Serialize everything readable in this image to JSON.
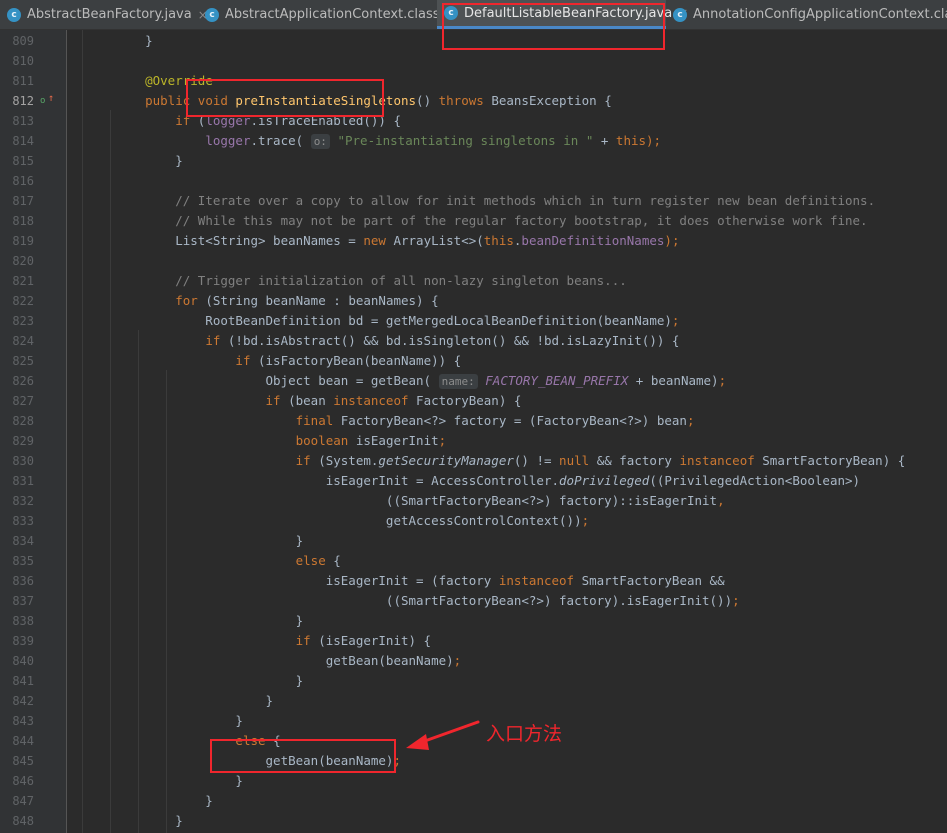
{
  "tabs": [
    {
      "name": "AbstractBeanFactory.java",
      "icon": "c",
      "active": false
    },
    {
      "name": "AbstractApplicationContext.class",
      "icon": "c",
      "active": false
    },
    {
      "name": "DefaultListableBeanFactory.java",
      "icon": "c",
      "active": true
    },
    {
      "name": "AnnotationConfigApplicationContext.class",
      "icon": "c",
      "active": false
    }
  ],
  "close_glyph": "×",
  "current_line": "812",
  "gutter_markers": [
    "o",
    "↑"
  ],
  "annotation_note": "入口方法",
  "lines": [
    {
      "n": "809",
      "t": [
        {
          "s": "    }"
        }
      ]
    },
    {
      "n": "810",
      "t": []
    },
    {
      "n": "811",
      "t": [
        {
          "s": "    "
        },
        {
          "s": "@Override",
          "c": "an"
        }
      ]
    },
    {
      "n": "812",
      "t": [
        {
          "s": "    "
        },
        {
          "s": "public void ",
          "c": "kw"
        },
        {
          "s": "preInstantiateSingletons",
          "c": "fnd"
        },
        {
          "s": "() "
        },
        {
          "s": "throws ",
          "c": "kw"
        },
        {
          "s": "BeansException {"
        }
      ]
    },
    {
      "n": "813",
      "t": [
        {
          "s": "        "
        },
        {
          "s": "if ",
          "c": "kw"
        },
        {
          "s": "("
        },
        {
          "s": "logger",
          "c": "fld"
        },
        {
          "s": ".isTraceEnabled()) {"
        }
      ]
    },
    {
      "n": "814",
      "t": [
        {
          "s": "            "
        },
        {
          "s": "logger",
          "c": "fld"
        },
        {
          "s": ".trace( "
        },
        {
          "s": "o:",
          "c": "hint"
        },
        {
          "s": " "
        },
        {
          "s": "\"Pre-instantiating singletons in \"",
          "c": "str"
        },
        {
          "s": " + "
        },
        {
          "s": "this",
          "c": "kw"
        },
        {
          "s": ");",
          "c": "kw"
        }
      ]
    },
    {
      "n": "815",
      "t": [
        {
          "s": "        }"
        }
      ]
    },
    {
      "n": "816",
      "t": []
    },
    {
      "n": "817",
      "t": [
        {
          "s": "        "
        },
        {
          "s": "// Iterate over a copy to allow for init methods which in turn register new bean definitions.",
          "c": "cmt"
        }
      ]
    },
    {
      "n": "818",
      "t": [
        {
          "s": "        "
        },
        {
          "s": "// While this may not be part of the regular factory bootstrap, it does otherwise work fine.",
          "c": "cmt"
        }
      ]
    },
    {
      "n": "819",
      "t": [
        {
          "s": "        List<String> beanNames = "
        },
        {
          "s": "new ",
          "c": "kw"
        },
        {
          "s": "ArrayList<>("
        },
        {
          "s": "this",
          "c": "kw"
        },
        {
          "s": "."
        },
        {
          "s": "beanDefinitionNames",
          "c": "fld"
        },
        {
          "s": ");",
          "c": "kw"
        }
      ]
    },
    {
      "n": "820",
      "t": []
    },
    {
      "n": "821",
      "t": [
        {
          "s": "        "
        },
        {
          "s": "// Trigger initialization of all non-lazy singleton beans...",
          "c": "cmt"
        }
      ]
    },
    {
      "n": "822",
      "t": [
        {
          "s": "        "
        },
        {
          "s": "for ",
          "c": "kw"
        },
        {
          "s": "(String beanName : beanNames) {"
        }
      ]
    },
    {
      "n": "823",
      "t": [
        {
          "s": "            RootBeanDefinition bd = getMergedLocalBeanDefinition(beanName)"
        },
        {
          "s": ";",
          "c": "kw"
        }
      ]
    },
    {
      "n": "824",
      "t": [
        {
          "s": "            "
        },
        {
          "s": "if ",
          "c": "kw"
        },
        {
          "s": "(!bd.isAbstract() && bd.isSingleton() && !bd.isLazyInit()) {"
        }
      ]
    },
    {
      "n": "825",
      "t": [
        {
          "s": "                "
        },
        {
          "s": "if ",
          "c": "kw"
        },
        {
          "s": "(isFactoryBean(beanName)) {"
        }
      ]
    },
    {
      "n": "826",
      "t": [
        {
          "s": "                    Object bean = getBean( "
        },
        {
          "s": "name:",
          "c": "hint"
        },
        {
          "s": " "
        },
        {
          "s": "FACTORY_BEAN_PREFIX",
          "c": "cst"
        },
        {
          "s": " + beanName)"
        },
        {
          "s": ";",
          "c": "kw"
        }
      ]
    },
    {
      "n": "827",
      "t": [
        {
          "s": "                    "
        },
        {
          "s": "if ",
          "c": "kw"
        },
        {
          "s": "(bean "
        },
        {
          "s": "instanceof ",
          "c": "kw"
        },
        {
          "s": "FactoryBean) {"
        }
      ]
    },
    {
      "n": "828",
      "t": [
        {
          "s": "                        "
        },
        {
          "s": "final ",
          "c": "kw"
        },
        {
          "s": "FactoryBean<?> factory = (FactoryBean<?>) bean"
        },
        {
          "s": ";",
          "c": "kw"
        }
      ]
    },
    {
      "n": "829",
      "t": [
        {
          "s": "                        "
        },
        {
          "s": "boolean ",
          "c": "kw"
        },
        {
          "s": "isEagerInit"
        },
        {
          "s": ";",
          "c": "kw"
        }
      ]
    },
    {
      "n": "830",
      "t": [
        {
          "s": "                        "
        },
        {
          "s": "if ",
          "c": "kw"
        },
        {
          "s": "(System."
        },
        {
          "s": "getSecurityManager",
          "c": "it"
        },
        {
          "s": "() != "
        },
        {
          "s": "null ",
          "c": "kw"
        },
        {
          "s": "&& factory "
        },
        {
          "s": "instanceof ",
          "c": "kw"
        },
        {
          "s": "SmartFactoryBean) {"
        }
      ]
    },
    {
      "n": "831",
      "t": [
        {
          "s": "                            isEagerInit = AccessController."
        },
        {
          "s": "doPrivileged",
          "c": "it"
        },
        {
          "s": "((PrivilegedAction<Boolean>)"
        }
      ]
    },
    {
      "n": "832",
      "t": [
        {
          "s": "                                    ((SmartFactoryBean<?>) factory)::isEagerInit"
        },
        {
          "s": ",",
          "c": "kw"
        }
      ]
    },
    {
      "n": "833",
      "t": [
        {
          "s": "                                    getAccessControlContext())"
        },
        {
          "s": ";",
          "c": "kw"
        }
      ]
    },
    {
      "n": "834",
      "t": [
        {
          "s": "                        }"
        }
      ]
    },
    {
      "n": "835",
      "t": [
        {
          "s": "                        "
        },
        {
          "s": "else ",
          "c": "kw"
        },
        {
          "s": "{"
        }
      ]
    },
    {
      "n": "836",
      "t": [
        {
          "s": "                            isEagerInit = (factory "
        },
        {
          "s": "instanceof ",
          "c": "kw"
        },
        {
          "s": "SmartFactoryBean &&"
        }
      ]
    },
    {
      "n": "837",
      "t": [
        {
          "s": "                                    ((SmartFactoryBean<?>) factory).isEagerInit())"
        },
        {
          "s": ";",
          "c": "kw"
        }
      ]
    },
    {
      "n": "838",
      "t": [
        {
          "s": "                        }"
        }
      ]
    },
    {
      "n": "839",
      "t": [
        {
          "s": "                        "
        },
        {
          "s": "if ",
          "c": "kw"
        },
        {
          "s": "(isEagerInit) {"
        }
      ]
    },
    {
      "n": "840",
      "t": [
        {
          "s": "                            getBean(beanName)"
        },
        {
          "s": ";",
          "c": "kw"
        }
      ]
    },
    {
      "n": "841",
      "t": [
        {
          "s": "                        }"
        }
      ]
    },
    {
      "n": "842",
      "t": [
        {
          "s": "                    }"
        }
      ]
    },
    {
      "n": "843",
      "t": [
        {
          "s": "                }"
        }
      ]
    },
    {
      "n": "844",
      "t": [
        {
          "s": "                "
        },
        {
          "s": "else ",
          "c": "kw"
        },
        {
          "s": "{"
        }
      ]
    },
    {
      "n": "845",
      "t": [
        {
          "s": "                    getBean(beanName)"
        },
        {
          "s": ";",
          "c": "kw"
        }
      ]
    },
    {
      "n": "846",
      "t": [
        {
          "s": "                }"
        }
      ]
    },
    {
      "n": "847",
      "t": [
        {
          "s": "            }"
        }
      ]
    },
    {
      "n": "848",
      "t": [
        {
          "s": "        }"
        }
      ]
    }
  ]
}
